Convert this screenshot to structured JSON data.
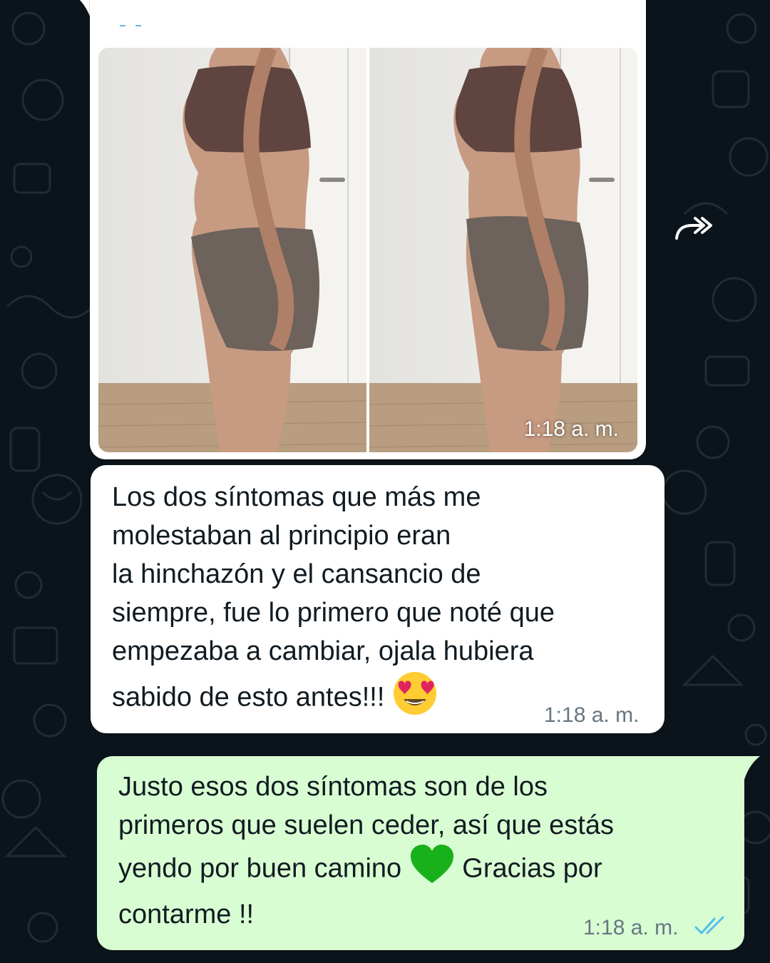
{
  "colors": {
    "background": "#0b141a",
    "incoming_bubble": "#ffffff",
    "outgoing_bubble": "#d9fdd3",
    "timestamp": "#667781",
    "read_ticks": "#53bdeb",
    "pattern": "#1f2c33"
  },
  "forward_button": {
    "icon": "forward-icon"
  },
  "media_message": {
    "images": [
      "photo-before",
      "photo-after"
    ],
    "time": "1:18 a. m."
  },
  "incoming_message": {
    "text": "Los dos síntomas que más me\nmolestaban al principio eran\nla hinchazón y el cansancio de\nsiempre, fue lo primero que noté que\nempezaba a cambiar, ojala hubiera\nsabido de esto antes!!!",
    "emoji": "heart-eyes-emoji",
    "time": "1:18 a. m."
  },
  "outgoing_message": {
    "text_before_emoji": "Justo esos dos síntomas son de los\nprimeros que suelen ceder, así que estás\nyendo por buen camino",
    "emoji": "green-heart-emoji",
    "text_after_emoji": "Gracias por\ncontarme !!",
    "time": "1:18 a. m.",
    "status_icon": "double-check-icon"
  }
}
